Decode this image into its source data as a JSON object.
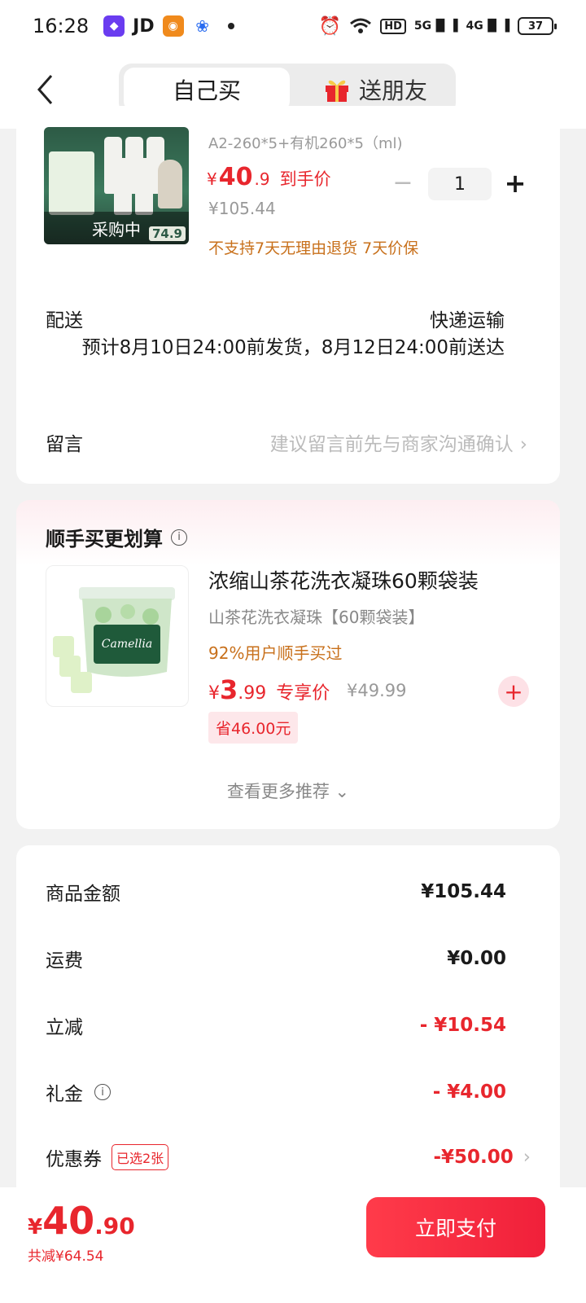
{
  "status_bar": {
    "time": "16:28",
    "jd_label": "JD",
    "network": "HD",
    "signal1": "5G",
    "signal2": "4G",
    "battery": "37"
  },
  "header": {
    "tab_self": "自己买",
    "tab_friend": "送朋友"
  },
  "product": {
    "spec": "A2-260*5+有机260*5（ml)",
    "price_symbol": "¥",
    "price_int": "40",
    "price_dec": ".9",
    "price_label": "到手价",
    "original_price": "¥105.44",
    "quantity": "1",
    "note": "不支持7天无理由退货  7天价保",
    "image_overlay": "采购中",
    "image_price": "74.9"
  },
  "delivery": {
    "label": "配送",
    "method": "快递运输",
    "eta": "预计8月10日24:00前发货，8月12日24:00前送达"
  },
  "message": {
    "label": "留言",
    "placeholder": "建议留言前先与商家沟通确认"
  },
  "recommend": {
    "title": "顺手买更划算",
    "name": "浓缩山茶花洗衣凝珠60颗袋装",
    "spec": "山茶花洗衣凝珠【60颗袋装】",
    "tag": "92%用户顺手买过",
    "price_symbol": "¥",
    "price_int": "3",
    "price_dec": ".99",
    "price_label": "专享价",
    "original_price": "¥49.99",
    "save": "省46.00元",
    "more": "查看更多推荐"
  },
  "summary": {
    "goods_label": "商品金额",
    "goods_value": "¥105.44",
    "shipping_label": "运费",
    "shipping_value": "¥0.00",
    "discount_label": "立减",
    "discount_value": "- ¥10.54",
    "gift_label": "礼金",
    "gift_value": "- ¥4.00",
    "coupon_label": "优惠券",
    "coupon_tag": "已选2张",
    "coupon_value": "-¥50.00"
  },
  "bottom": {
    "total_symbol": "¥",
    "total_int": "40",
    "total_dec": ".90",
    "saved": "共减¥64.54",
    "pay_label": "立即支付"
  },
  "colors": {
    "accent_red": "#e8262d",
    "orange_note": "#c8701b",
    "background": "#f2f2f2"
  }
}
